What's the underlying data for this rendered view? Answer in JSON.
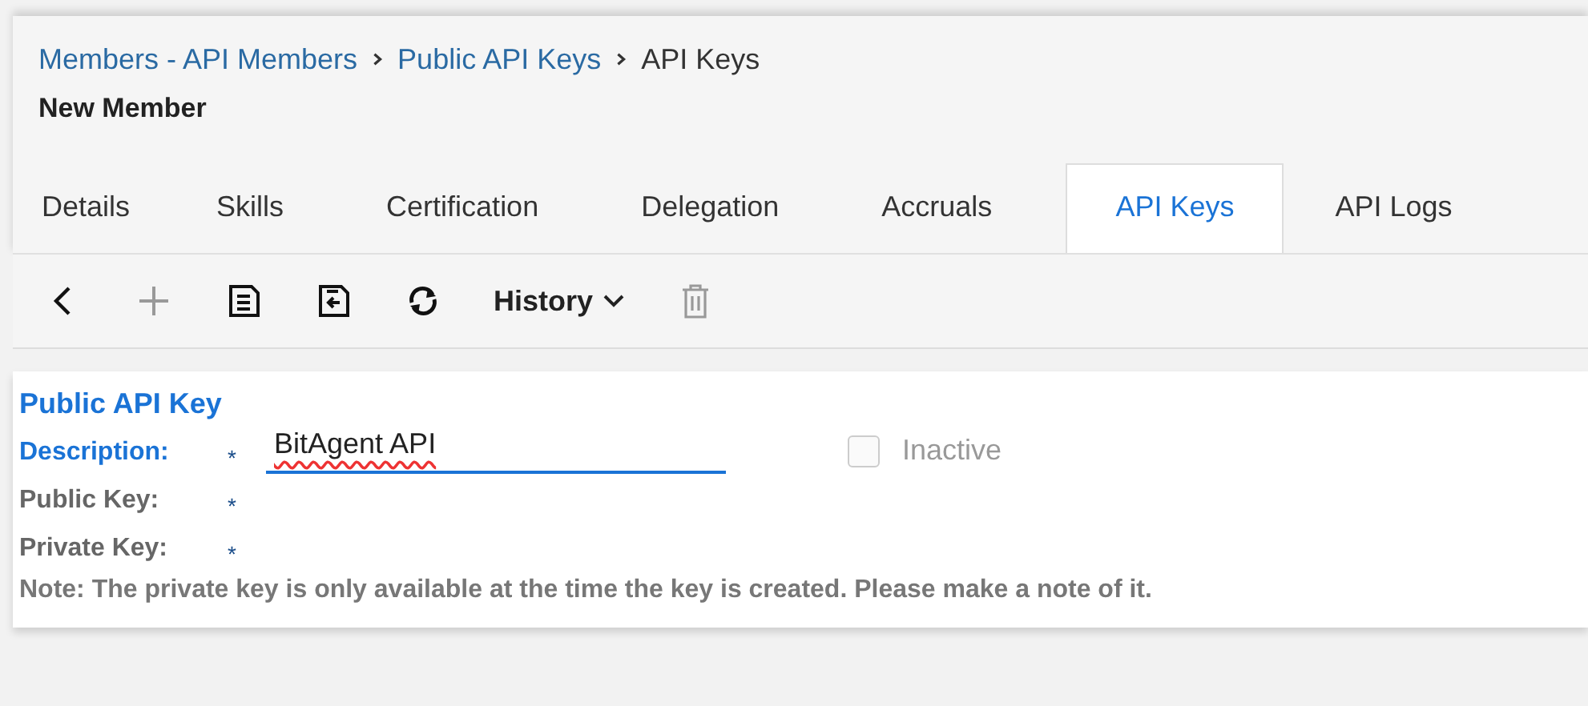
{
  "breadcrumbs": [
    {
      "label": "Members - API Members",
      "link": true
    },
    {
      "label": "Public API Keys",
      "link": true
    },
    {
      "label": "API Keys",
      "link": false
    }
  ],
  "page_title": "New Member",
  "tabs": [
    {
      "label": "Details",
      "selected": false
    },
    {
      "label": "Skills",
      "selected": false
    },
    {
      "label": "Certification",
      "selected": false
    },
    {
      "label": "Delegation",
      "selected": false
    },
    {
      "label": "Accruals",
      "selected": false
    },
    {
      "label": "API Keys",
      "selected": true
    },
    {
      "label": "API Logs",
      "selected": false
    }
  ],
  "toolbar": [
    {
      "kind": "back",
      "disabled": false
    },
    {
      "kind": "add",
      "disabled": true
    },
    {
      "kind": "save",
      "disabled": false
    },
    {
      "kind": "save-close",
      "disabled": false
    },
    {
      "kind": "refresh",
      "disabled": false
    },
    {
      "kind": "history",
      "label": "History",
      "disabled": false
    },
    {
      "kind": "delete",
      "disabled": true
    }
  ],
  "section_title": "Public API Key",
  "fields": [
    {
      "label": "Description:",
      "required_mark": "*",
      "value": "BitAgent API",
      "focused": true
    },
    {
      "label": "Public Key:",
      "required_mark": "*",
      "focused": false
    },
    {
      "label": "Private Key:",
      "required_mark": "*",
      "focused": false
    }
  ],
  "inactive": {
    "label": "Inactive",
    "checked": false,
    "disabled": true
  },
  "note": "Note: The private key is only available at the time the key is created. Please make a note of it."
}
